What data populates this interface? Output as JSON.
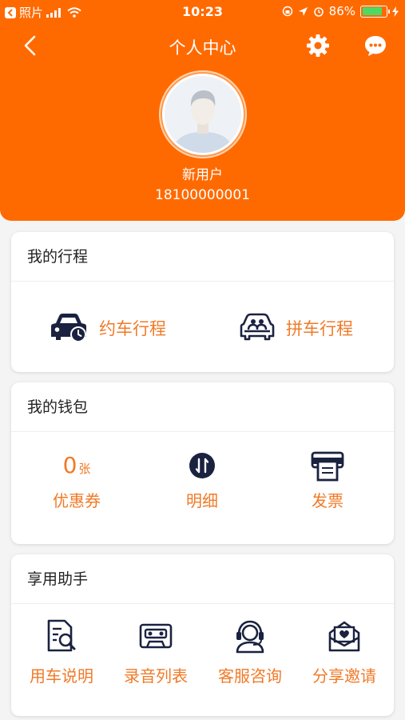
{
  "status_bar": {
    "back_app": "照片",
    "time": "10:23",
    "battery": "86%",
    "battery_level": 0.86
  },
  "nav": {
    "title": "个人中心"
  },
  "profile": {
    "name": "新用户",
    "phone": "18100000001"
  },
  "trips": {
    "title": "我的行程",
    "items": [
      {
        "label": "约车行程",
        "icon": "car-clock-icon"
      },
      {
        "label": "拼车行程",
        "icon": "carpool-icon"
      }
    ]
  },
  "wallet": {
    "title": "我的钱包",
    "coupon_count": "0",
    "coupon_unit": "张",
    "items": [
      {
        "label": "优惠券",
        "icon": "coupon-count"
      },
      {
        "label": "明细",
        "icon": "transfer-icon"
      },
      {
        "label": "发票",
        "icon": "printer-icon"
      }
    ]
  },
  "assistant": {
    "title": "享用助手",
    "items": [
      {
        "label": "用车说明",
        "icon": "document-search-icon"
      },
      {
        "label": "录音列表",
        "icon": "cassette-icon"
      },
      {
        "label": "客服咨询",
        "icon": "headset-icon"
      },
      {
        "label": "分享邀请",
        "icon": "envelope-heart-icon"
      }
    ]
  },
  "colors": {
    "brand": "#ff6a00",
    "accent_text": "#f07a28",
    "icon": "#1a2240",
    "background": "#f4f4f4"
  }
}
